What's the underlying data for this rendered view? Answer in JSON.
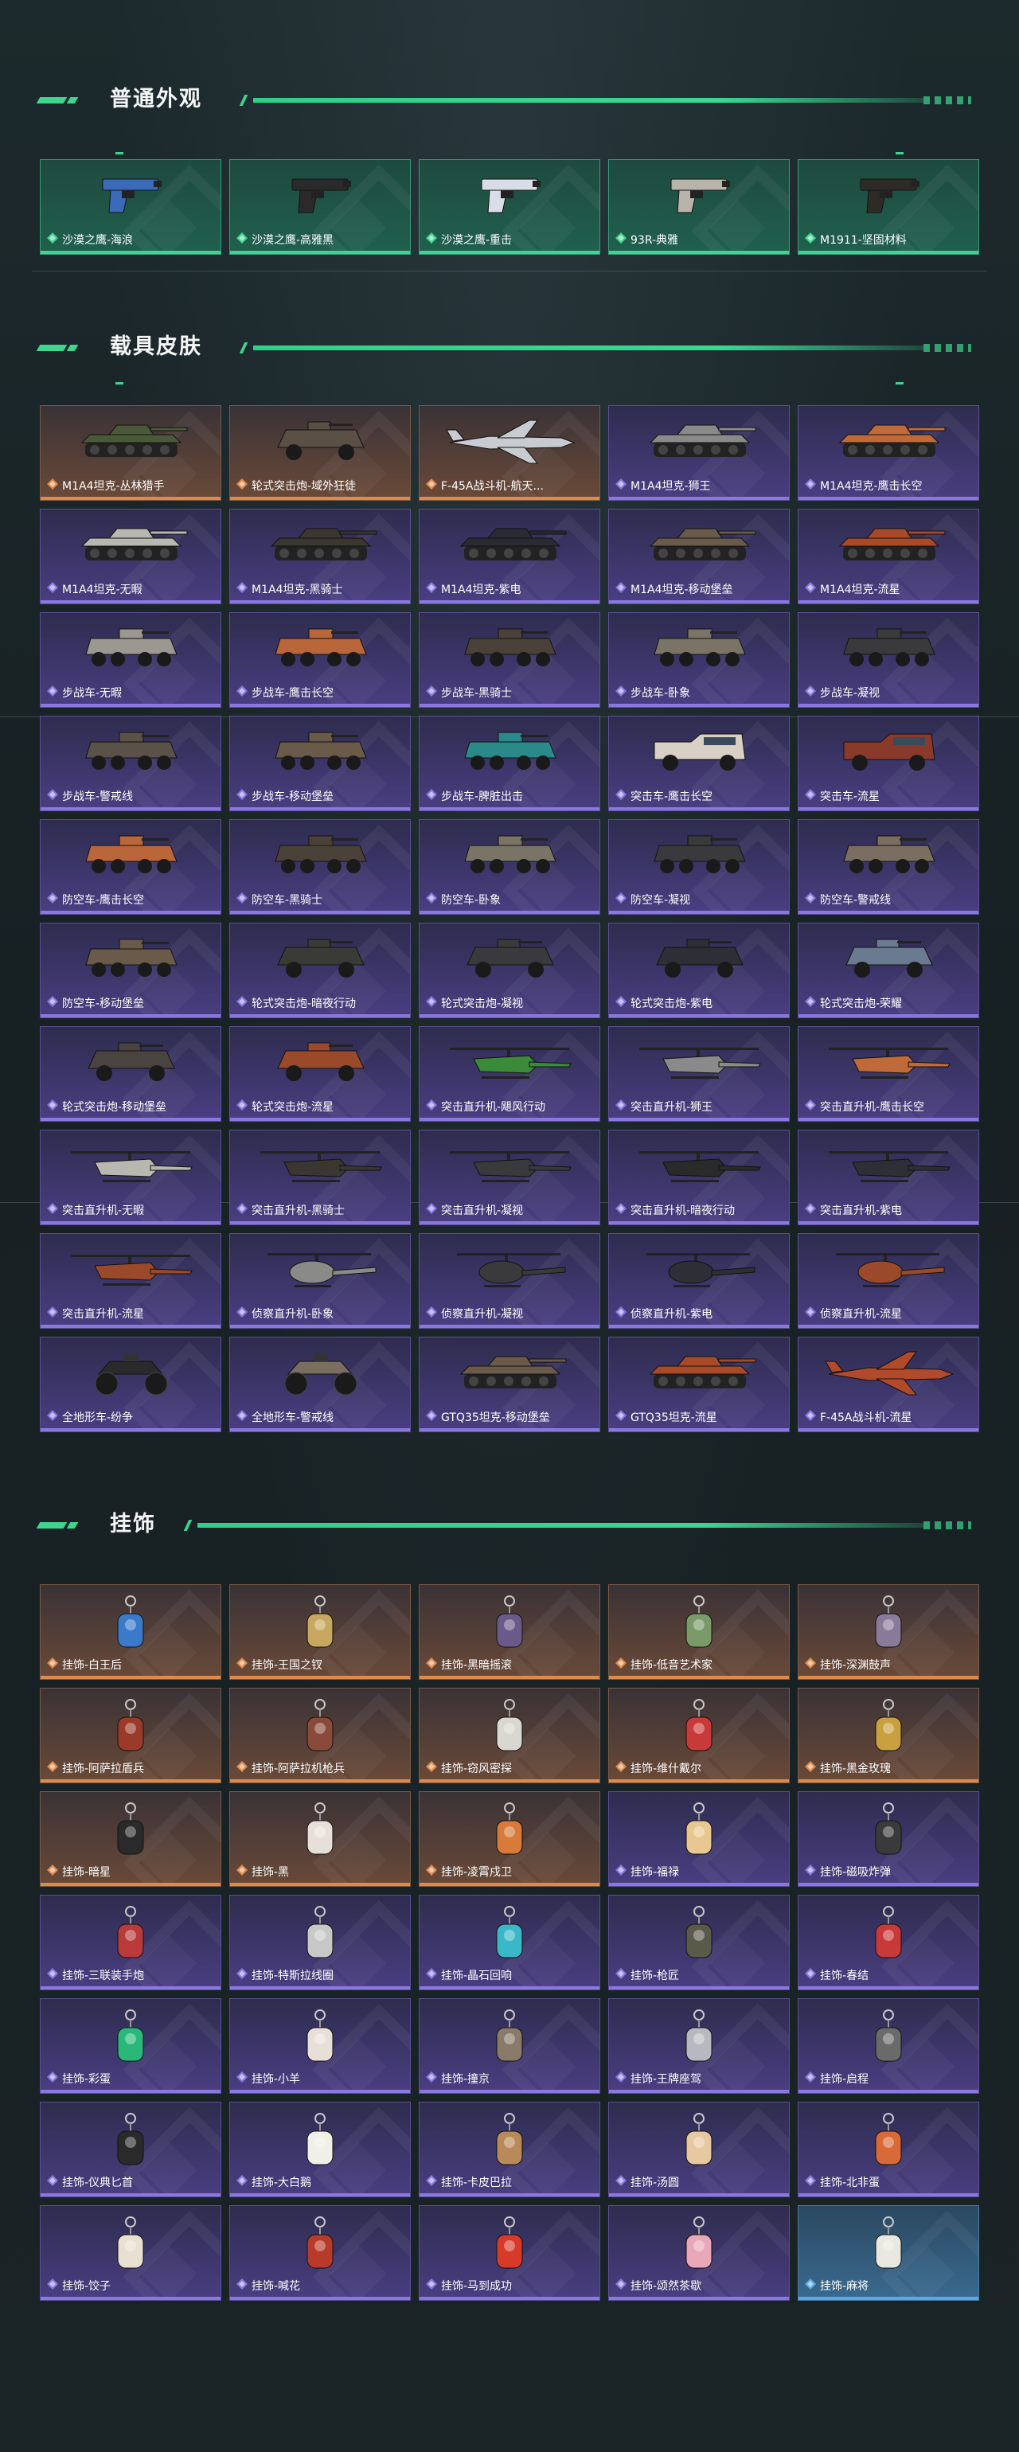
{
  "sections": {
    "weapon": {
      "title": "普通外观",
      "items": [
        {
          "label": "沙漠之鹰-海浪",
          "rarity": "green",
          "kind": "pistol",
          "color": "#3a6ab8"
        },
        {
          "label": "沙漠之鹰-高雅黑",
          "rarity": "green",
          "kind": "pistol",
          "color": "#2a2a2a"
        },
        {
          "label": "沙漠之鹰-重击",
          "rarity": "green",
          "kind": "pistol",
          "color": "#d8dde8"
        },
        {
          "label": "93R-典雅",
          "rarity": "green",
          "kind": "pistol",
          "color": "#b8b4ac"
        },
        {
          "label": "M1911-坚固材料",
          "rarity": "green",
          "kind": "pistol",
          "color": "#2e2a26"
        }
      ]
    },
    "vehicle": {
      "title": "载具皮肤",
      "items": [
        {
          "label": "M1A4坦克-丛林猎手",
          "rarity": "orange",
          "kind": "tank",
          "color": "#4a5a38"
        },
        {
          "label": "轮式突击炮-域外狂徒",
          "rarity": "orange",
          "kind": "wheeled",
          "color": "#5a5046"
        },
        {
          "label": "F-45A战斗机-航天...",
          "rarity": "orange",
          "kind": "jet",
          "color": "#c8ccd0"
        },
        {
          "label": "M1A4坦克-狮王",
          "rarity": "purple",
          "kind": "tank",
          "color": "#8a8a8a"
        },
        {
          "label": "M1A4坦克-鹰击长空",
          "rarity": "purple",
          "kind": "tank",
          "color": "#c06a3a"
        },
        {
          "label": "M1A4坦克-无暇",
          "rarity": "purple",
          "kind": "tank",
          "color": "#b8b8b0"
        },
        {
          "label": "M1A4坦克-黑骑士",
          "rarity": "purple",
          "kind": "tank",
          "color": "#3a3630"
        },
        {
          "label": "M1A4坦克-紫电",
          "rarity": "purple",
          "kind": "tank",
          "color": "#2a2a34"
        },
        {
          "label": "M1A4坦克-移动堡垒",
          "rarity": "purple",
          "kind": "tank",
          "color": "#6a5a4a"
        },
        {
          "label": "M1A4坦克-流星",
          "rarity": "purple",
          "kind": "tank",
          "color": "#a84a2a"
        },
        {
          "label": "步战车-无暇",
          "rarity": "purple",
          "kind": "ifv",
          "color": "#9a9890"
        },
        {
          "label": "步战车-鹰击长空",
          "rarity": "purple",
          "kind": "ifv",
          "color": "#b8663a"
        },
        {
          "label": "步战车-黑骑士",
          "rarity": "purple",
          "kind": "ifv",
          "color": "#4a4238"
        },
        {
          "label": "步战车-卧象",
          "rarity": "purple",
          "kind": "ifv",
          "color": "#7a7466"
        },
        {
          "label": "步战车-凝视",
          "rarity": "purple",
          "kind": "ifv",
          "color": "#3a3a3c"
        },
        {
          "label": "步战车-警戒线",
          "rarity": "purple",
          "kind": "ifv",
          "color": "#5a5248"
        },
        {
          "label": "步战车-移动堡垒",
          "rarity": "purple",
          "kind": "ifv",
          "color": "#6a5a4a"
        },
        {
          "label": "步战车-脾脏出击",
          "rarity": "purple",
          "kind": "ifv",
          "color": "#2a8a8a"
        },
        {
          "label": "突击车-鹰击长空",
          "rarity": "purple",
          "kind": "truck",
          "color": "#d8d0c4"
        },
        {
          "label": "突击车-流星",
          "rarity": "purple",
          "kind": "truck",
          "color": "#8a3a2a"
        },
        {
          "label": "防空车-鹰击长空",
          "rarity": "purple",
          "kind": "ifv",
          "color": "#b8663a"
        },
        {
          "label": "防空车-黑骑士",
          "rarity": "purple",
          "kind": "ifv",
          "color": "#4a4238"
        },
        {
          "label": "防空车-卧象",
          "rarity": "purple",
          "kind": "ifv",
          "color": "#7a7466"
        },
        {
          "label": "防空车-凝视",
          "rarity": "purple",
          "kind": "ifv",
          "color": "#3a3a3c"
        },
        {
          "label": "防空车-警戒线",
          "rarity": "purple",
          "kind": "ifv",
          "color": "#7a6e60"
        },
        {
          "label": "防空车-移动堡垒",
          "rarity": "purple",
          "kind": "ifv",
          "color": "#6a5a4a"
        },
        {
          "label": "轮式突击炮-暗夜行动",
          "rarity": "purple",
          "kind": "wheeled",
          "color": "#3a3a36"
        },
        {
          "label": "轮式突击炮-凝视",
          "rarity": "purple",
          "kind": "wheeled",
          "color": "#3a3a3c"
        },
        {
          "label": "轮式突击炮-紫电",
          "rarity": "purple",
          "kind": "wheeled",
          "color": "#2e2e36"
        },
        {
          "label": "轮式突击炮-荣耀",
          "rarity": "purple",
          "kind": "wheeled",
          "color": "#6a7a90"
        },
        {
          "label": "轮式突击炮-移动堡垒",
          "rarity": "purple",
          "kind": "wheeled",
          "color": "#4a4440"
        },
        {
          "label": "轮式突击炮-流星",
          "rarity": "purple",
          "kind": "wheeled",
          "color": "#9a4a2a"
        },
        {
          "label": "突击直升机-飓风行动",
          "rarity": "purple",
          "kind": "heli",
          "color": "#3a8a3a"
        },
        {
          "label": "突击直升机-狮王",
          "rarity": "purple",
          "kind": "heli",
          "color": "#8a8a8a"
        },
        {
          "label": "突击直升机-鹰击长空",
          "rarity": "purple",
          "kind": "heli",
          "color": "#c06a3a"
        },
        {
          "label": "突击直升机-无暇",
          "rarity": "purple",
          "kind": "heli",
          "color": "#b8b8b0"
        },
        {
          "label": "突击直升机-黑骑士",
          "rarity": "purple",
          "kind": "heli",
          "color": "#3a3630"
        },
        {
          "label": "突击直升机-凝视",
          "rarity": "purple",
          "kind": "heli",
          "color": "#3a3a3c"
        },
        {
          "label": "突击直升机-暗夜行动",
          "rarity": "purple",
          "kind": "heli",
          "color": "#2a2a2a"
        },
        {
          "label": "突击直升机-紫电",
          "rarity": "purple",
          "kind": "heli",
          "color": "#2e2e36"
        },
        {
          "label": "突击直升机-流星",
          "rarity": "purple",
          "kind": "heli",
          "color": "#9a4a2a"
        },
        {
          "label": "侦察直升机-卧象",
          "rarity": "purple",
          "kind": "scout",
          "color": "#8a8a88"
        },
        {
          "label": "侦察直升机-凝视",
          "rarity": "purple",
          "kind": "scout",
          "color": "#3a3a3c"
        },
        {
          "label": "侦察直升机-紫电",
          "rarity": "purple",
          "kind": "scout",
          "color": "#2e2e36"
        },
        {
          "label": "侦察直升机-流星",
          "rarity": "purple",
          "kind": "scout",
          "color": "#9a4a2a"
        },
        {
          "label": "全地形车-纷争",
          "rarity": "purple",
          "kind": "atv",
          "color": "#2a2a2a"
        },
        {
          "label": "全地形车-警戒线",
          "rarity": "purple",
          "kind": "atv",
          "color": "#7a6e60"
        },
        {
          "label": "GTQ35坦克-移动堡垒",
          "rarity": "purple",
          "kind": "tank",
          "color": "#6a5a4a"
        },
        {
          "label": "GTQ35坦克-流星",
          "rarity": "purple",
          "kind": "tank",
          "color": "#a84a2a"
        },
        {
          "label": "F-45A战斗机-流星",
          "rarity": "purple",
          "kind": "jet",
          "color": "#b04a2a"
        }
      ]
    },
    "charm": {
      "title": "挂饰",
      "items": [
        {
          "label": "挂饰-白王后",
          "rarity": "orange",
          "kind": "charm",
          "color": "#3a7ac8"
        },
        {
          "label": "挂饰-王国之钗",
          "rarity": "orange",
          "kind": "charm",
          "color": "#c8a860"
        },
        {
          "label": "挂饰-黑暗摇滚",
          "rarity": "orange",
          "kind": "charm",
          "color": "#6a5a8a"
        },
        {
          "label": "挂饰-低音艺术家",
          "rarity": "orange",
          "kind": "charm",
          "color": "#7a9a6a"
        },
        {
          "label": "挂饰-深渊鼓声",
          "rarity": "orange",
          "kind": "charm",
          "color": "#8a7a9a"
        },
        {
          "label": "挂饰-阿萨拉盾兵",
          "rarity": "orange",
          "kind": "charm",
          "color": "#9a3a2a"
        },
        {
          "label": "挂饰-阿萨拉机枪兵",
          "rarity": "orange",
          "kind": "charm",
          "color": "#8a4a3a"
        },
        {
          "label": "挂饰-窃风密探",
          "rarity": "orange",
          "kind": "charm",
          "color": "#d8d8d0"
        },
        {
          "label": "挂饰-维什戴尔",
          "rarity": "orange",
          "kind": "charm",
          "color": "#c83a3a"
        },
        {
          "label": "挂饰-黑金玫瑰",
          "rarity": "orange",
          "kind": "charm",
          "color": "#c8a040"
        },
        {
          "label": "挂饰-暗星",
          "rarity": "orange",
          "kind": "charm",
          "color": "#2a2a2a"
        },
        {
          "label": "挂饰-黑",
          "rarity": "orange",
          "kind": "charm",
          "color": "#e8e0d8"
        },
        {
          "label": "挂饰-凌霄戍卫",
          "rarity": "orange",
          "kind": "charm",
          "color": "#d87a3a"
        },
        {
          "label": "挂饰-福禄",
          "rarity": "purple",
          "kind": "charm",
          "color": "#e8c890"
        },
        {
          "label": "挂饰-磁吸炸弹",
          "rarity": "purple",
          "kind": "charm",
          "color": "#3a3a3a"
        },
        {
          "label": "挂饰-三联装手炮",
          "rarity": "purple",
          "kind": "charm",
          "color": "#b83a3a"
        },
        {
          "label": "挂饰-特斯拉线圈",
          "rarity": "purple",
          "kind": "charm",
          "color": "#c8c8c8"
        },
        {
          "label": "挂饰-晶石回响",
          "rarity": "purple",
          "kind": "charm",
          "color": "#3ab8c8"
        },
        {
          "label": "挂饰-枪匠",
          "rarity": "purple",
          "kind": "charm",
          "color": "#5a5a4a"
        },
        {
          "label": "挂饰-春结",
          "rarity": "purple",
          "kind": "charm",
          "color": "#c83a3a"
        },
        {
          "label": "挂饰-彩蛋",
          "rarity": "purple",
          "kind": "charm",
          "color": "#2ab87a"
        },
        {
          "label": "挂饰-小羊",
          "rarity": "purple",
          "kind": "charm",
          "color": "#e8e0d8"
        },
        {
          "label": "挂饰-撞京",
          "rarity": "purple",
          "kind": "charm",
          "color": "#8a7a6a"
        },
        {
          "label": "挂饰-王牌座驾",
          "rarity": "purple",
          "kind": "charm",
          "color": "#b8b8c0"
        },
        {
          "label": "挂饰-启程",
          "rarity": "purple",
          "kind": "charm",
          "color": "#6a6a6a"
        },
        {
          "label": "挂饰-仪典匕首",
          "rarity": "purple",
          "kind": "charm",
          "color": "#2a2a2a"
        },
        {
          "label": "挂饰-大白鹅",
          "rarity": "purple",
          "kind": "charm",
          "color": "#f0f0e8"
        },
        {
          "label": "挂饰-卡皮巴拉",
          "rarity": "purple",
          "kind": "charm",
          "color": "#b88a5a"
        },
        {
          "label": "挂饰-汤圆",
          "rarity": "purple",
          "kind": "charm",
          "color": "#e8c8a0"
        },
        {
          "label": "挂饰-北非蛋",
          "rarity": "purple",
          "kind": "charm",
          "color": "#d86a3a"
        },
        {
          "label": "挂饰-饺子",
          "rarity": "purple",
          "kind": "charm",
          "color": "#e8e0d0"
        },
        {
          "label": "挂饰-喊花",
          "rarity": "purple",
          "kind": "charm",
          "color": "#b83a2a"
        },
        {
          "label": "挂饰-马到成功",
          "rarity": "purple",
          "kind": "charm",
          "color": "#d83a2a"
        },
        {
          "label": "挂饰-颂然茶歇",
          "rarity": "purple",
          "kind": "charm",
          "color": "#e8a8b8"
        },
        {
          "label": "挂饰-麻将",
          "rarity": "blue",
          "kind": "charm",
          "color": "#e8e8e0"
        }
      ]
    }
  },
  "colors": {
    "accent": "#3fd58f",
    "green": "#3fd58f",
    "orange": "#e08a4a",
    "purple": "#8a78e0",
    "blue": "#5aa8e8"
  }
}
